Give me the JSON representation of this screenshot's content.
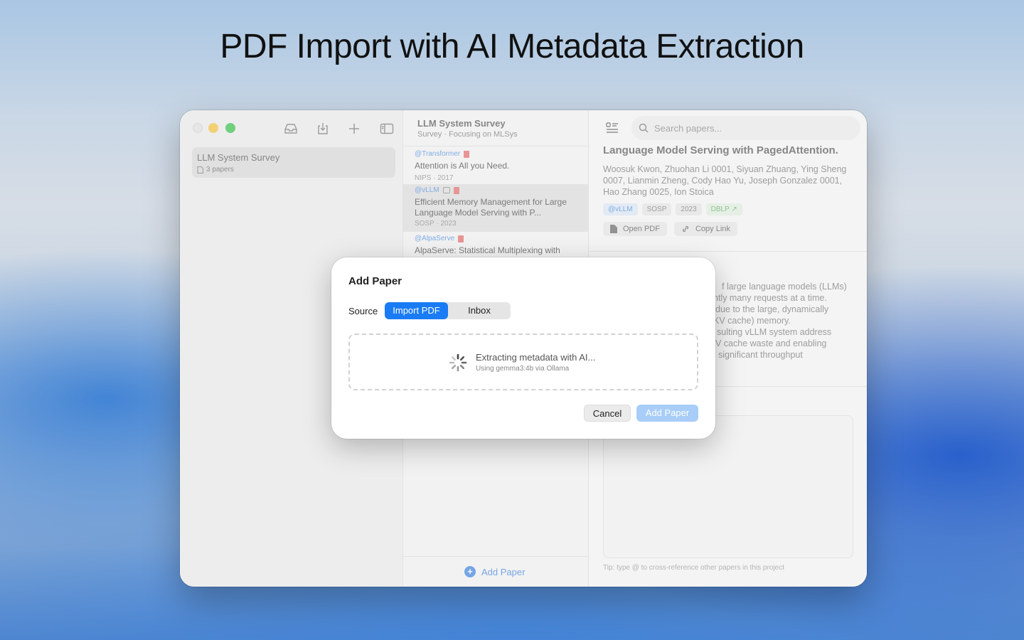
{
  "headline": "PDF Import with AI Metadata Extraction",
  "sidebar": {
    "project": {
      "name": "LLM System Survey",
      "count": "3 papers"
    }
  },
  "list": {
    "title": "LLM System Survey",
    "subtitle": "Survey · Focusing on MLSys",
    "papers": [
      {
        "cite": "@Transformer",
        "title": "Attention is All you Need.",
        "venue": "NIPS · 2017"
      },
      {
        "cite": "@vLLM",
        "title": "Efficient Memory Management for Large Language Model Serving with P...",
        "venue": "SOSP · 2023"
      },
      {
        "cite": "@AlpaServe",
        "title": "AlpaServe: Statistical Multiplexing with",
        "venue": ""
      }
    ],
    "add_label": "Add Paper"
  },
  "detail": {
    "search_placeholder": "Search papers...",
    "title": "Language Model Serving with PagedAttention.",
    "authors": "Woosuk Kwon, Zhuohan Li 0001, Siyuan Zhuang, Ying Sheng 0007, Lianmin Zheng, Cody Hao Yu, Joseph Gonzalez 0001, Hao Zhang 0025, Ion Stoica",
    "tags": [
      "@vLLM",
      "SOSP",
      "2023",
      "DBLP ↗"
    ],
    "open_pdf": "Open PDF",
    "copy_link": "Copy Link",
    "abstract_lines": [
      "f large language models (LLMs)",
      "ntly many requests at a time.",
      "due to the large, dynamically",
      "KV cache) memory.",
      "sulting vLLM system address",
      "V cache waste and enabling",
      "significant throughput"
    ],
    "tip": "Tip: type @ to cross-reference other papers in this project"
  },
  "dialog": {
    "title": "Add Paper",
    "source_label": "Source",
    "source_options": [
      "Import PDF",
      "Inbox"
    ],
    "status_main": "Extracting metadata with AI...",
    "status_sub": "Using gemma3:4b via Ollama",
    "cancel": "Cancel",
    "add": "Add Paper"
  }
}
